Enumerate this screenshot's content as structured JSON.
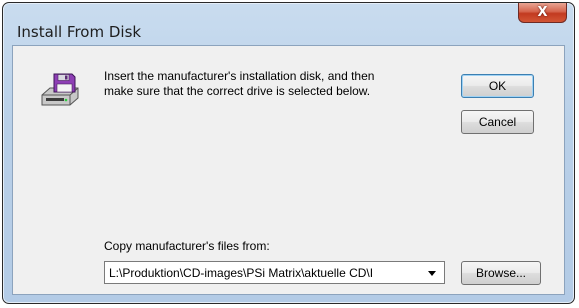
{
  "window": {
    "title": "Install From Disk",
    "close_label": "X"
  },
  "icons": {
    "disk": "floppy-disk-install-icon",
    "close": "close-icon",
    "dropdown": "chevron-down-icon"
  },
  "message": "Insert the manufacturer's installation disk, and then\nmake sure that the correct drive is selected below.",
  "buttons": {
    "ok": "OK",
    "cancel": "Cancel",
    "browse": "Browse..."
  },
  "copy_from": {
    "label": "Copy manufacturer's files from:",
    "value": "L:\\Produktion\\CD-images\\PSi Matrix\\aktuelle CD\\I"
  },
  "colors": {
    "title_bar": "#b9d0e8",
    "client_bg": "#f0f0f0",
    "close_button": "#c23a20",
    "default_button_border": "#3c7fb1"
  }
}
